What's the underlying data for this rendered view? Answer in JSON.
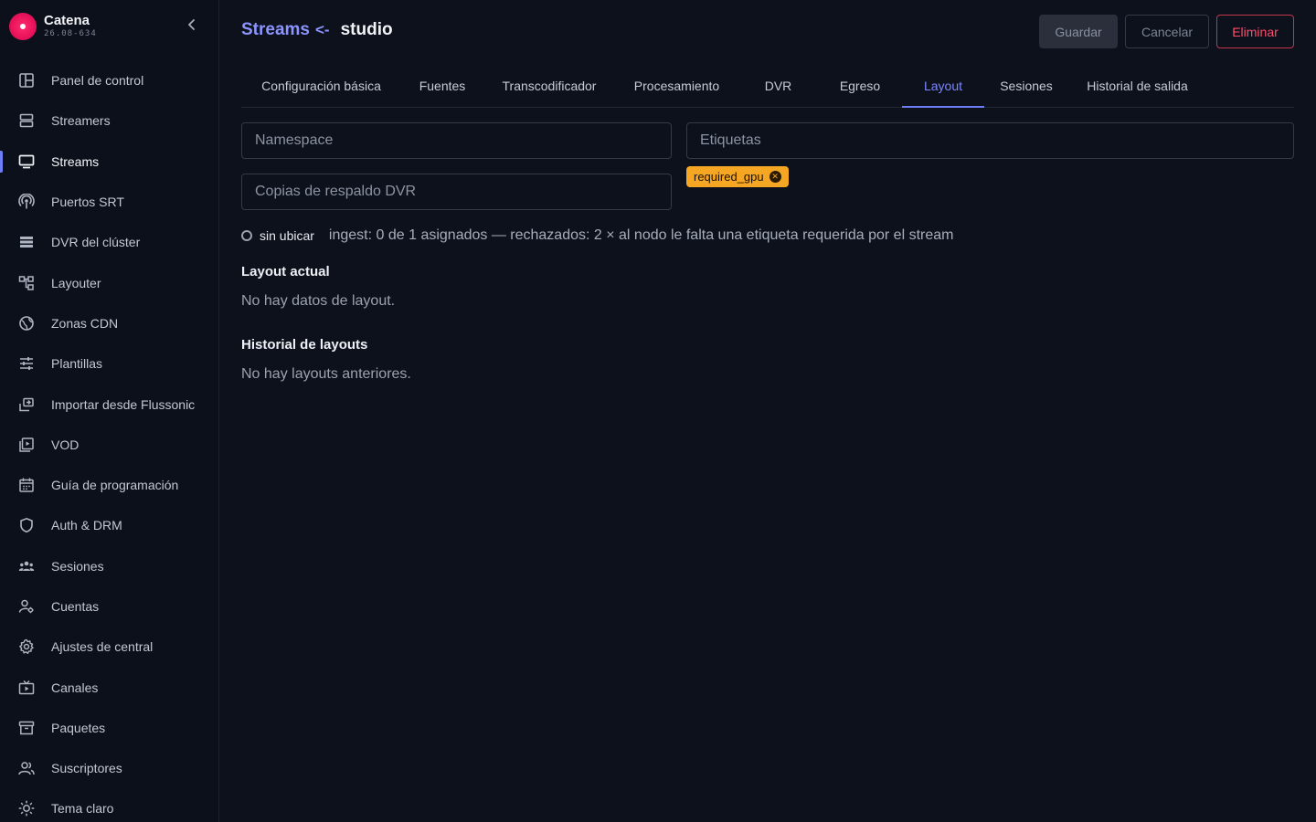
{
  "brand": {
    "name": "Catena",
    "version": "26.08-634"
  },
  "sidebar": {
    "items": [
      {
        "label": "Panel de control",
        "icon": "dashboard-icon",
        "active": false
      },
      {
        "label": "Streamers",
        "icon": "server-icon",
        "active": false
      },
      {
        "label": "Streams",
        "icon": "monitor-icon",
        "active": true
      },
      {
        "label": "Puertos SRT",
        "icon": "antenna-icon",
        "active": false
      },
      {
        "label": "DVR del clúster",
        "icon": "storage-icon",
        "active": false
      },
      {
        "label": "Layouter",
        "icon": "hierarchy-icon",
        "active": false
      },
      {
        "label": "Zonas CDN",
        "icon": "globe-icon",
        "active": false
      },
      {
        "label": "Plantillas",
        "icon": "sliders-icon",
        "active": false
      },
      {
        "label": "Importar desde Flussonic",
        "icon": "import-icon",
        "active": false
      },
      {
        "label": "VOD",
        "icon": "video-library-icon",
        "active": false
      },
      {
        "label": "Guía de programación",
        "icon": "calendar-icon",
        "active": false
      },
      {
        "label": "Auth & DRM",
        "icon": "shield-icon",
        "active": false
      },
      {
        "label": "Sesiones",
        "icon": "group-icon",
        "active": false
      },
      {
        "label": "Cuentas",
        "icon": "user-settings-icon",
        "active": false
      },
      {
        "label": "Ajustes de central",
        "icon": "gear-icon",
        "active": false
      },
      {
        "label": "Canales",
        "icon": "tv-icon",
        "active": false
      },
      {
        "label": "Paquetes",
        "icon": "archive-icon",
        "active": false
      },
      {
        "label": "Suscriptores",
        "icon": "users-icon",
        "active": false
      },
      {
        "label": "Tema claro",
        "icon": "sun-icon",
        "active": false
      }
    ]
  },
  "header": {
    "breadcrumb_link": "Streams",
    "breadcrumb_sep": "<-",
    "title": "studio",
    "save_label": "Guardar",
    "cancel_label": "Cancelar",
    "delete_label": "Eliminar"
  },
  "tabs": [
    {
      "label": "Configuración básica",
      "active": false
    },
    {
      "label": "Fuentes",
      "active": false
    },
    {
      "label": "Transcodificador",
      "active": false
    },
    {
      "label": "Procesamiento",
      "active": false
    },
    {
      "label": "DVR",
      "active": false
    },
    {
      "label": "Egreso",
      "active": false
    },
    {
      "label": "Layout",
      "active": true
    },
    {
      "label": "Sesiones",
      "active": false
    },
    {
      "label": "Historial de salida",
      "active": false
    }
  ],
  "form": {
    "namespace_placeholder": "Namespace",
    "namespace_value": "",
    "tags_placeholder": "Etiquetas",
    "tags_value": "",
    "dvr_backup_placeholder": "Copias de respaldo DVR",
    "dvr_backup_value": "",
    "tag_chip": "required_gpu"
  },
  "placement": {
    "state": "sin ubicar",
    "detail": "ingest: 0 de 1 asignados — rechazados: 2 × al nodo le falta una etiqueta requerida por el stream"
  },
  "layout_current": {
    "title": "Layout actual",
    "empty": "No hay datos de layout."
  },
  "layout_history": {
    "title": "Historial de layouts",
    "empty": "No hay layouts anteriores."
  },
  "colors": {
    "accent": "#6f7cf7",
    "chip": "#f5a623",
    "danger": "#ff4d6a",
    "brand": "#e8125a"
  }
}
